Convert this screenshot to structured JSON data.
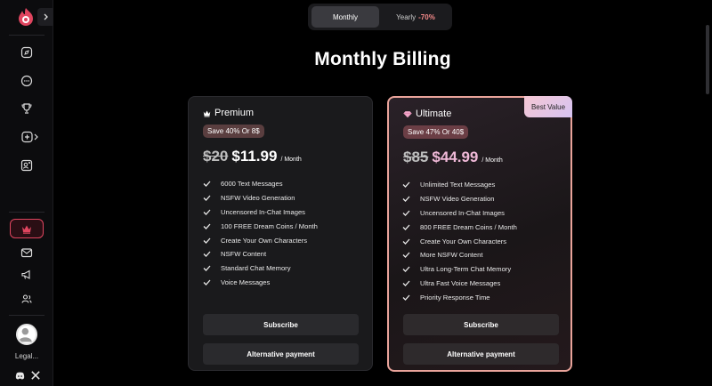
{
  "sidebar": {
    "legal_label": "Legal...",
    "nav": [
      {
        "icon": "compass-icon"
      },
      {
        "icon": "chat-icon"
      },
      {
        "icon": "trophy-icon"
      },
      {
        "icon": "create-icon"
      },
      {
        "icon": "profile-card-icon"
      },
      {
        "icon": "crown-icon"
      },
      {
        "icon": "mail-icon"
      },
      {
        "icon": "megaphone-icon"
      },
      {
        "icon": "users-icon"
      }
    ],
    "social": [
      {
        "icon": "discord-icon"
      },
      {
        "icon": "x-icon"
      }
    ]
  },
  "billing_toggle": {
    "monthly_label": "Monthly",
    "yearly_label": "Yearly",
    "yearly_discount": "-70%",
    "selected": "Monthly"
  },
  "page_title": "Monthly Billing",
  "plans": [
    {
      "name": "Premium",
      "save_text": "Save 40% Or 8$",
      "old_price": "$20",
      "new_price": "$11.99",
      "period": "/ Month",
      "features": [
        "6000 Text Messages",
        "NSFW Video Generation",
        "Uncensored In-Chat Images",
        "100 FREE Dream Coins / Month",
        "Create Your Own Characters",
        "NSFW Content",
        "Standard Chat Memory",
        "Voice Messages"
      ],
      "subscribe_label": "Subscribe",
      "alt_payment_label": "Alternative payment"
    },
    {
      "name": "Ultimate",
      "badge": "Best Value",
      "save_text": "Save 47% Or 40$",
      "old_price": "$85",
      "new_price": "$44.99",
      "period": "/ Month",
      "features": [
        "Unlimited Text Messages",
        "NSFW Video Generation",
        "Uncensored In-Chat Images",
        "800 FREE Dream Coins / Month",
        "Create Your Own Characters",
        "More NSFW Content",
        "Ultra Long-Term Chat Memory",
        "Ultra Fast Voice Messages",
        "Priority Response Time"
      ],
      "subscribe_label": "Subscribe",
      "alt_payment_label": "Alternative payment"
    }
  ],
  "colors": {
    "accent": "#e0455f",
    "ultimate_border": "#e9a39a",
    "ultimate_price": "#f0b9d8",
    "discount": "#f58a8a"
  }
}
